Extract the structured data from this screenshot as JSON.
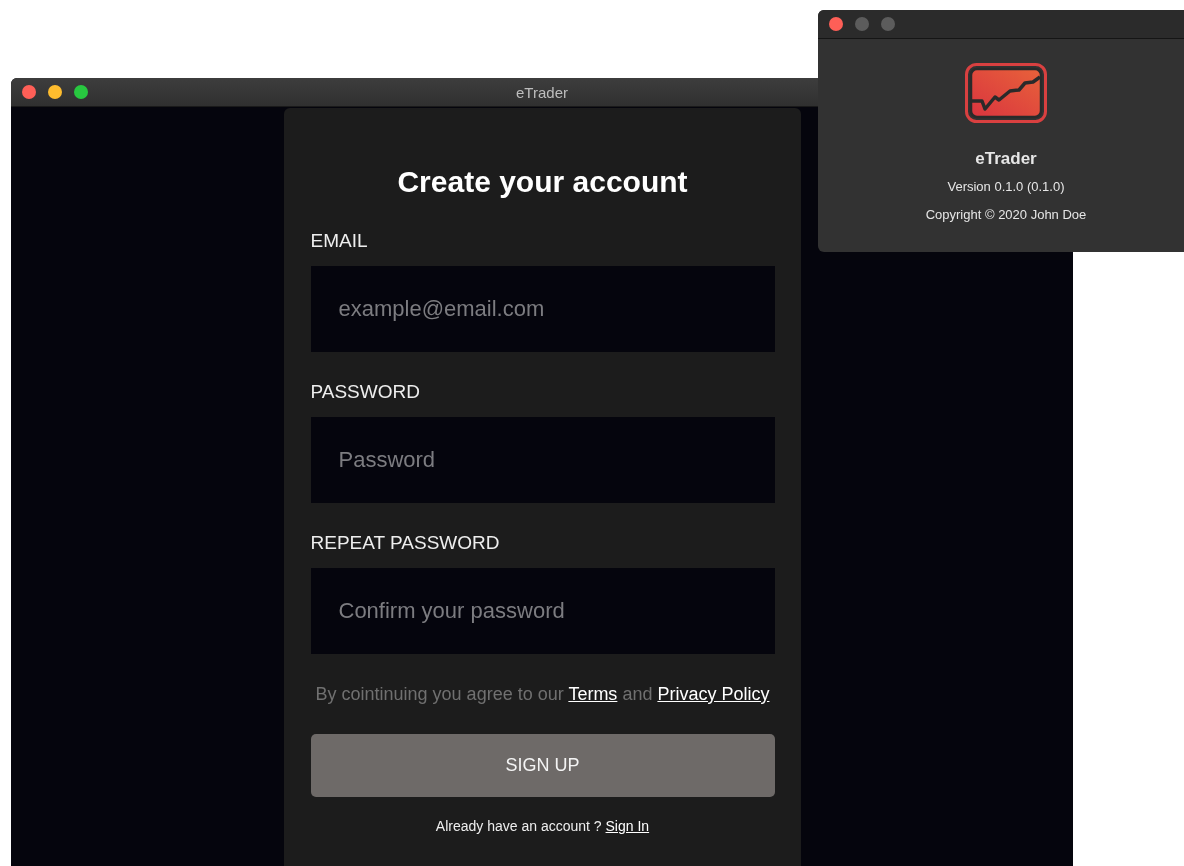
{
  "main_window": {
    "title": "eTrader"
  },
  "signup": {
    "heading": "Create your account",
    "fields": [
      {
        "label": "EMAIL",
        "placeholder": "example@email.com"
      },
      {
        "label": "PASSWORD",
        "placeholder": "Password"
      },
      {
        "label": "REPEAT PASSWORD",
        "placeholder": "Confirm your password"
      }
    ],
    "agreement": {
      "text": "By cointinuing you agree to our",
      "terms_link": "Terms",
      "joiner": "and",
      "privacy_link": "Privacy Policy"
    },
    "submit_button": "SIGN UP",
    "signin": {
      "text": "Already have an account ?",
      "link": "Sign In"
    }
  },
  "about_window": {
    "app_name": "eTrader",
    "version": "Version 0.1.0 (0.1.0)",
    "copyright": "Copyright © 2020 John Doe"
  }
}
